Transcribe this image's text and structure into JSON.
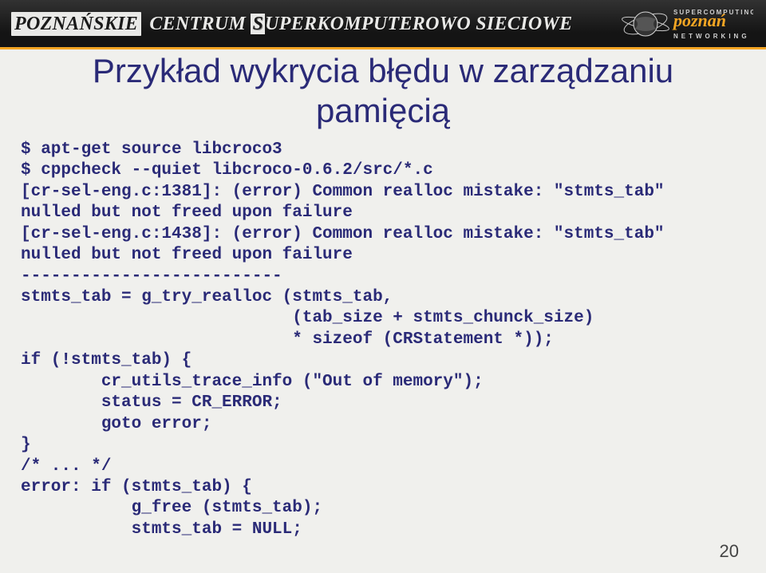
{
  "header": {
    "org_box1": "POZNAŃSKIE",
    "org_mid": "CENTRUM",
    "org_box2": "S",
    "org_mid2": "UPERKOMPUTEROWO",
    "org_last": "SIECIOWE",
    "logo_top": "SUPERCOMPUTING",
    "logo_bottom": "NETWORKING"
  },
  "title": "Przykład wykrycia błędu w zarządzaniu pamięcią",
  "code_lines": [
    "$ apt-get source libcroco3",
    "$ cppcheck --quiet libcroco-0.6.2/src/*.c",
    "[cr-sel-eng.c:1381]: (error) Common realloc mistake: \"stmts_tab\"",
    "nulled but not freed upon failure",
    "[cr-sel-eng.c:1438]: (error) Common realloc mistake: \"stmts_tab\"",
    "nulled but not freed upon failure",
    "--------------------------",
    "stmts_tab = g_try_realloc (stmts_tab,",
    "                           (tab_size + stmts_chunck_size)",
    "                           * sizeof (CRStatement *));",
    "if (!stmts_tab) {",
    "        cr_utils_trace_info (\"Out of memory\");",
    "        status = CR_ERROR;",
    "        goto error;",
    "}",
    "/* ... */",
    "error: if (stmts_tab) {",
    "           g_free (stmts_tab);",
    "           stmts_tab = NULL;"
  ],
  "page_number": "20"
}
